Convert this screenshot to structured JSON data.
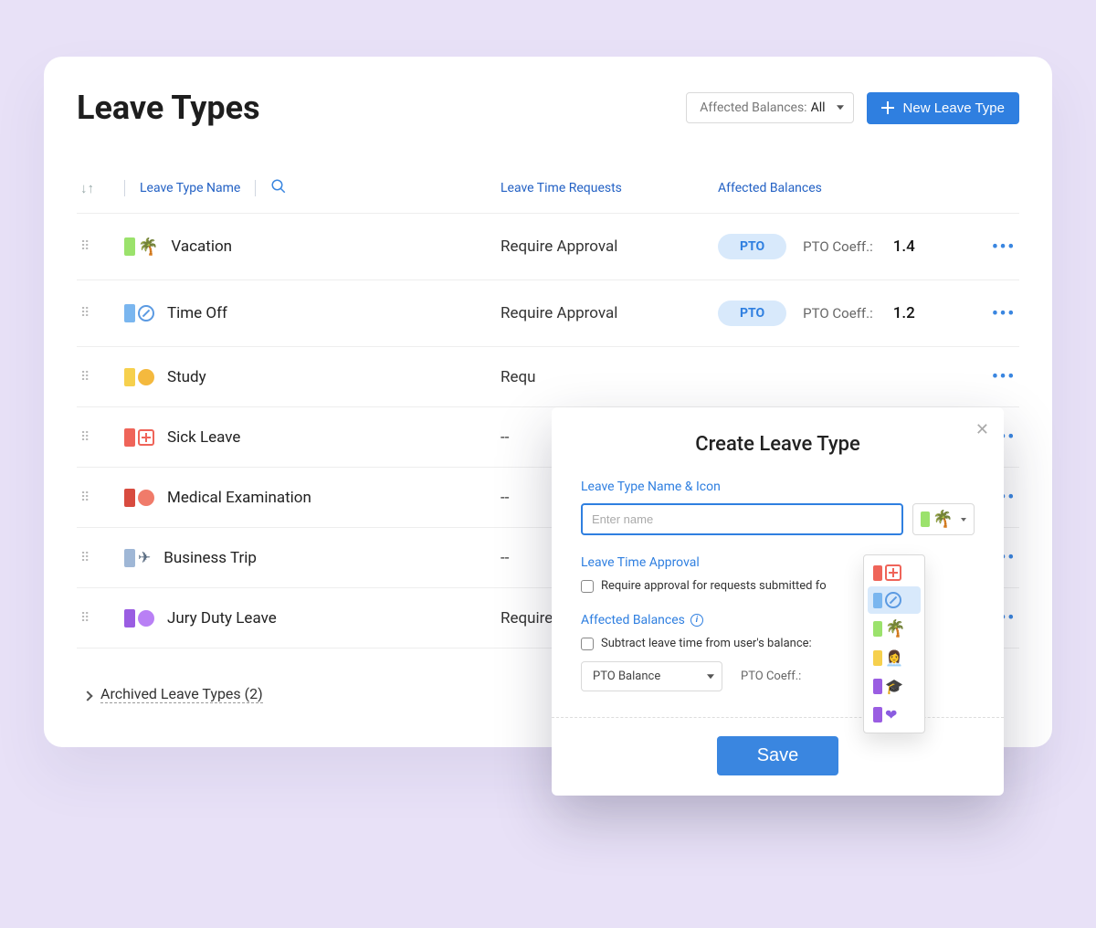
{
  "header": {
    "title": "Leave Types",
    "filter_label": "Affected Balances:",
    "filter_value": "All",
    "new_button": "New Leave Type"
  },
  "columns": {
    "name": "Leave Type Name",
    "requests": "Leave Time Requests",
    "balances": "Affected Balances"
  },
  "pto_pill": "PTO",
  "coef_label": "PTO Coeff.:",
  "rows": [
    {
      "name": "Vacation",
      "request": "Require Approval",
      "pto": true,
      "coef": "1.4",
      "icon": "palm",
      "sq": "g-green"
    },
    {
      "name": "Time Off",
      "request": "Require Approval",
      "pto": true,
      "coef": "1.2",
      "icon": "slash",
      "sq": "g-blue"
    },
    {
      "name": "Study",
      "request": "Requ",
      "pto": false,
      "coef": "",
      "icon": "circle",
      "sq": "g-yellow",
      "circ": "c-yellow"
    },
    {
      "name": "Sick Leave",
      "request": "--",
      "pto": false,
      "coef": "",
      "icon": "medcross",
      "sq": "g-red"
    },
    {
      "name": "Medical Examination",
      "request": "--",
      "pto": false,
      "coef": "",
      "icon": "circle",
      "sq": "g-dred",
      "circ": "c-orange"
    },
    {
      "name": "Business Trip",
      "request": "--",
      "pto": false,
      "coef": "",
      "icon": "plane",
      "sq": "g-bluegray"
    },
    {
      "name": "Jury Duty Leave",
      "request": "Require A",
      "pto": false,
      "coef": "",
      "icon": "circle",
      "sq": "g-purple",
      "circ": "c-purple"
    }
  ],
  "archived": "Archived Leave Types (2)",
  "modal": {
    "title": "Create Leave Type",
    "name_section": "Leave Type Name & Icon",
    "name_placeholder": "Enter name",
    "approval_section": "Leave Time Approval",
    "approval_check": "Require approval for requests submitted fo",
    "balances_section": "Affected Balances",
    "subtract_check": "Subtract leave time from user's balance:",
    "balance_select": "PTO Balance",
    "coef_label": "PTO Coeff.:",
    "save": "Save"
  },
  "icon_options": [
    {
      "sq": "g-red",
      "kind": "medcross",
      "sel": false
    },
    {
      "sq": "g-blue",
      "kind": "slash",
      "sel": true
    },
    {
      "sq": "g-green",
      "kind": "palm",
      "sel": false
    },
    {
      "sq": "g-yellow",
      "kind": "person",
      "sel": false
    },
    {
      "sq": "g-purple",
      "kind": "grad",
      "sel": false
    },
    {
      "sq": "g-purple",
      "kind": "paw",
      "sel": false
    }
  ]
}
